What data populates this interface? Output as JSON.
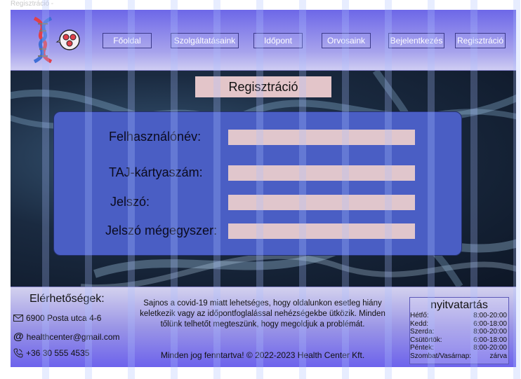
{
  "window": {
    "title": "Regisztráció -"
  },
  "nav": {
    "items": [
      {
        "label": "Főoldal"
      },
      {
        "label": "Szolgáltatásaink"
      },
      {
        "label": "Időpont"
      },
      {
        "label": "Orvosaink"
      },
      {
        "label": "Bejelentkezés"
      },
      {
        "label": "Regisztráció"
      }
    ]
  },
  "page": {
    "title": "Regisztráció"
  },
  "form": {
    "username_label": "Felhasználónév:",
    "taj_label": "TAJ-kártyaszám:",
    "password_label": "Jelszó:",
    "password_confirm_label": "Jelszó mégegyszer:"
  },
  "footer": {
    "contact_title": "Elérhetőségek:",
    "address": "6900 Posta utca 4-6",
    "email": "healthcenter@gmail.com",
    "phone": "+36 30 555 4535",
    "notice": "Sajnos a covid-19 miatt lehetséges, hogy oldalunkon esetleg hiány keletkezik vagy az időpontfoglalással nehézségekbe ütközik. Minden tőlünk telhetőt megteszünk, hogy megoldjuk a problémát.",
    "copyright": "Minden jog fenntartva! © 2022-2023 Health Center Kft.",
    "hours": {
      "title": "nyitvatartás",
      "rows": [
        {
          "day": "Hétfő:",
          "time": "8:00-20:00"
        },
        {
          "day": "Kedd:",
          "time": "6:00-18:00"
        },
        {
          "day": "Szerda:",
          "time": "8:00-20:00"
        },
        {
          "day": "Csütörtök:",
          "time": "6:00-18:00"
        },
        {
          "day": "Péntek:",
          "time": "8:00-20:00"
        },
        {
          "day": "Szombat/Vasárnap:",
          "time": "zárva"
        }
      ]
    }
  },
  "colors": {
    "header": "#6d67e8",
    "form_card": "#4a5ec4",
    "input": "#e0c6cc",
    "title_box": "#e3c5c9",
    "logo_blue": "#3f6fd6",
    "logo_red": "#e0404a"
  },
  "icons": {
    "logo": "dna-helix-icon",
    "logo_badge": "cells-icon",
    "address": "envelope-icon",
    "email": "at-sign-icon",
    "phone": "phone-icon"
  }
}
